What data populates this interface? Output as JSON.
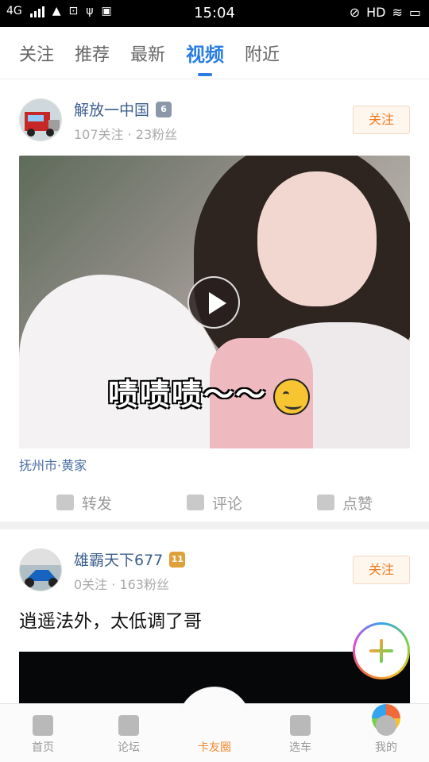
{
  "status_bar": {
    "network": "4G",
    "time": "15:04",
    "hd": "HD"
  },
  "tabs": [
    {
      "label": "关注"
    },
    {
      "label": "推荐"
    },
    {
      "label": "最新"
    },
    {
      "label": "视频",
      "active": true
    },
    {
      "label": "附近"
    }
  ],
  "posts": [
    {
      "username": "解放一中国",
      "level": "6",
      "meta": "107关注 · 23粉丝",
      "follow_label": "关注",
      "caption": "啧啧啧～～",
      "location": "抚州市·黄家",
      "actions": {
        "forward": "转发",
        "comment": "评论",
        "like": "点赞"
      }
    },
    {
      "username": "雄霸天下677",
      "level": "11",
      "meta": "0关注 · 163粉丝",
      "follow_label": "关注",
      "text": "逍遥法外，太低调了哥"
    }
  ],
  "bottom_nav": [
    {
      "label": "首页"
    },
    {
      "label": "论坛"
    },
    {
      "label": "卡友圈",
      "active": true
    },
    {
      "label": "选车"
    },
    {
      "label": "我的"
    }
  ],
  "colors": {
    "accent": "#2a7de1",
    "follow": "#f07a1c",
    "active_nav": "#f08a2c",
    "username": "#3d5f8e"
  }
}
